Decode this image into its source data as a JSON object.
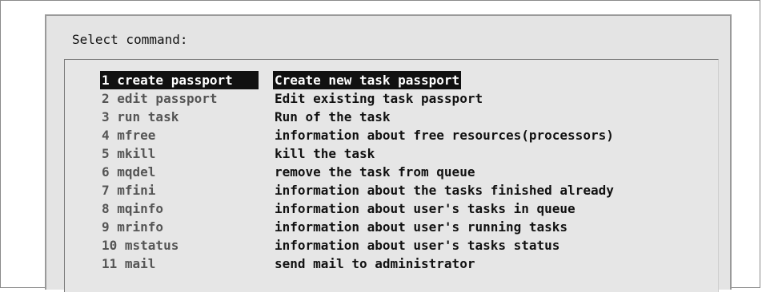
{
  "dialog": {
    "title": "Select command:"
  },
  "menu": {
    "selected_index": 0,
    "items": [
      {
        "command": "1 create passport",
        "description": "Create new task passport"
      },
      {
        "command": "2 edit passport",
        "description": "Edit existing task passport"
      },
      {
        "command": "3 run task",
        "description": "Run of the task"
      },
      {
        "command": "4 mfree",
        "description": "information about free resources(processors)"
      },
      {
        "command": "5 mkill",
        "description": "kill the task"
      },
      {
        "command": "6 mqdel",
        "description": "remove the task from queue"
      },
      {
        "command": "7 mfini",
        "description": "information about the tasks finished already"
      },
      {
        "command": "8 mqinfo",
        "description": "information about user's tasks in queue"
      },
      {
        "command": "9 mrinfo",
        "description": "information about user's running tasks"
      },
      {
        "command": "10 mstatus",
        "description": "information about user's tasks status"
      },
      {
        "command": "11 mail",
        "description": "send mail to administrator"
      }
    ]
  },
  "colors": {
    "highlight_background": "#111111",
    "highlight_text": "#ffffff",
    "dialog_background": "#e4e4e4"
  }
}
